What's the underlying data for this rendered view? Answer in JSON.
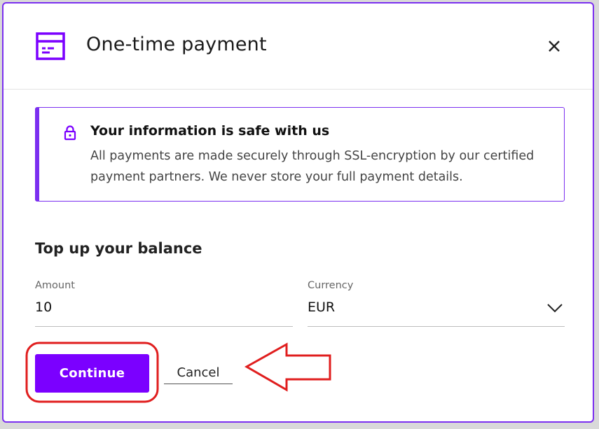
{
  "dialog": {
    "title": "One-time payment",
    "close_icon": "close-icon",
    "card_icon": "credit-card-icon"
  },
  "info": {
    "icon": "lock-icon",
    "title": "Your information is safe with us",
    "text": "All payments are made securely through SSL-encryption by our certified payment partners. We never store your full payment details."
  },
  "topup": {
    "title": "Top up your balance",
    "amount": {
      "label": "Amount",
      "value": "10"
    },
    "currency": {
      "label": "Currency",
      "value": "EUR",
      "icon": "chevron-down-icon"
    }
  },
  "actions": {
    "continue_label": "Continue",
    "cancel_label": "Cancel"
  },
  "colors": {
    "accent": "#7b00ff",
    "highlight": "#e01e1e"
  },
  "annotations": {
    "highlight_target": "continue-button",
    "arrow_icon": "left-arrow-icon"
  }
}
